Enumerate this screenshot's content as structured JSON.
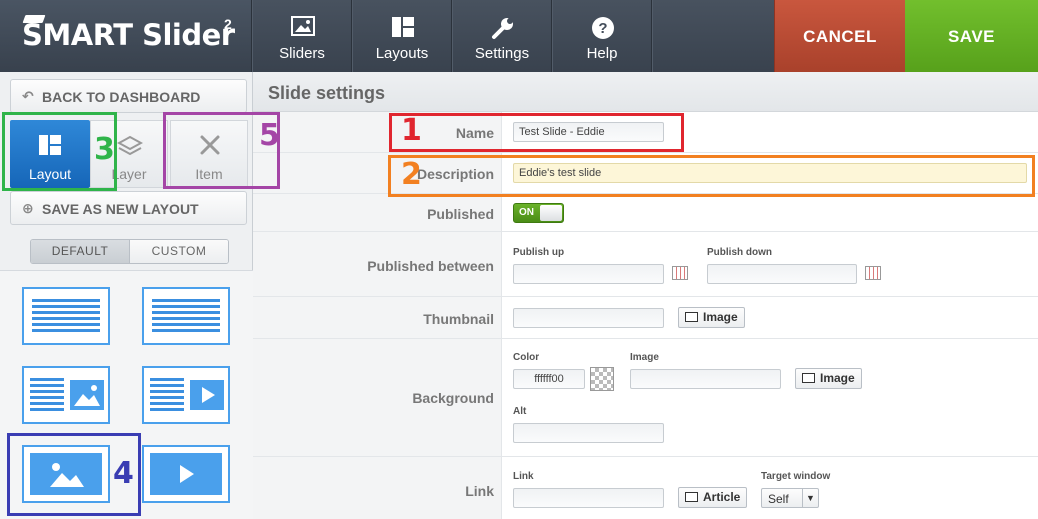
{
  "topbar": {
    "logo": "SMART Slider",
    "logo_sup": "2",
    "nav": [
      {
        "label": "Sliders",
        "icon": "image-icon"
      },
      {
        "label": "Layouts",
        "icon": "layout-icon"
      },
      {
        "label": "Settings",
        "icon": "wrench-icon"
      },
      {
        "label": "Help",
        "icon": "question-icon"
      }
    ],
    "cancel": "CANCEL",
    "save": "SAVE"
  },
  "sidebar": {
    "back": "BACK TO DASHBOARD",
    "tabs": {
      "layout": "Layout",
      "layer": "Layer",
      "item": "Item"
    },
    "save_layout": "SAVE AS NEW LAYOUT",
    "segment": {
      "default": "DEFAULT",
      "custom": "CUSTOM"
    }
  },
  "main": {
    "title": "Slide settings",
    "name": {
      "label": "Name",
      "value": "Test Slide - Eddie"
    },
    "description": {
      "label": "Description",
      "value": "Eddie's test slide"
    },
    "published": {
      "label": "Published",
      "value": "ON"
    },
    "published_between": {
      "label": "Published between",
      "up": "Publish up",
      "down": "Publish down"
    },
    "thumbnail": {
      "label": "Thumbnail",
      "button": "Image"
    },
    "background": {
      "label": "Background",
      "color_label": "Color",
      "color_value": "ffffff00",
      "image_label": "Image",
      "button": "Image",
      "alt_label": "Alt"
    },
    "link": {
      "label": "Link",
      "link_label": "Link",
      "article_button": "Article",
      "target_label": "Target window",
      "target_value": "Self"
    }
  },
  "annotations": {
    "n1": "1",
    "n2": "2",
    "n3": "3",
    "n4": "4",
    "n5": "5"
  },
  "colors": {
    "red": "#e0262f",
    "orange": "#f28021",
    "green": "#2fb44a",
    "purple": "#a445a6",
    "indigo": "#3a3db3"
  }
}
